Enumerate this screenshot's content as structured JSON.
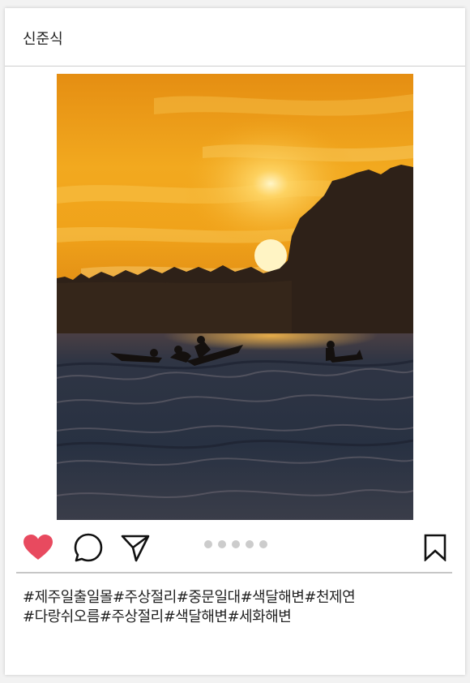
{
  "post": {
    "username": "신준식",
    "image_alt": "sunset surfers"
  },
  "actions": {
    "like_icon": "heart-icon",
    "like_color": "#e84a5f",
    "comment_icon": "comment-icon",
    "share_icon": "send-icon",
    "save_icon": "bookmark-icon",
    "carousel_dot_count": 5,
    "carousel_dot_color": "#cccccc"
  },
  "caption": {
    "line1": "#제주일출일몰#주상절리#중문일대#색달해변#천제연",
    "line2": "#다랑쉬오름#주상절리#색달해변#세화해변"
  }
}
